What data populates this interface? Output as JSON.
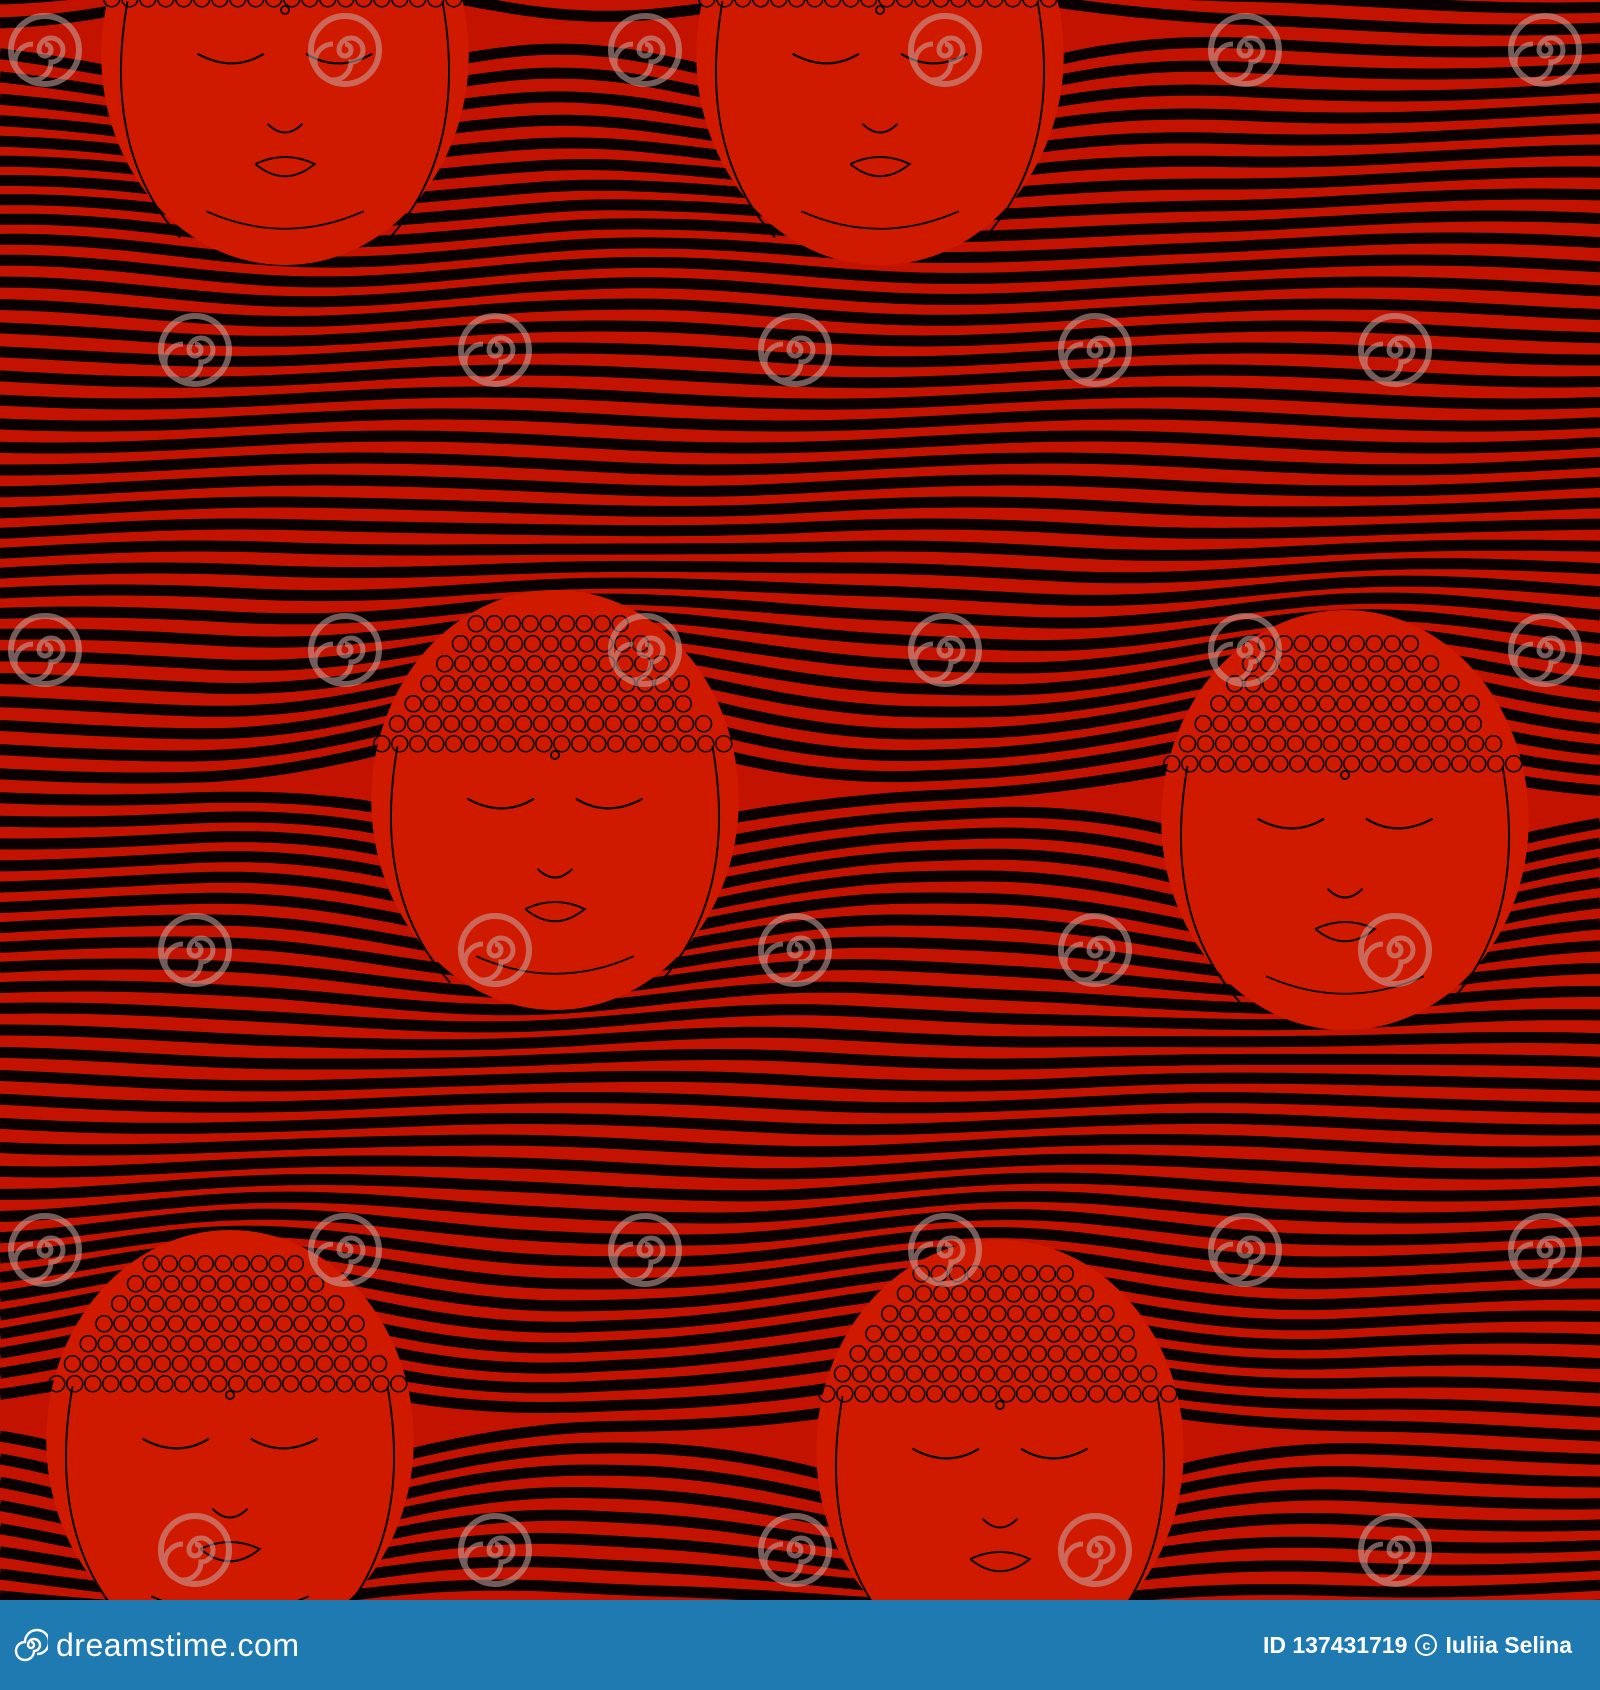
{
  "image": {
    "colors": {
      "background": "#c41200",
      "lines": "#0a0000",
      "face": "#d01a00",
      "footer": "#1e7ab0"
    },
    "watermark_text": "dreamstime"
  },
  "footer": {
    "site_label": "dreamstime.com",
    "image_id": "ID 137431719",
    "copyright_author": "Iuliia Selina"
  }
}
